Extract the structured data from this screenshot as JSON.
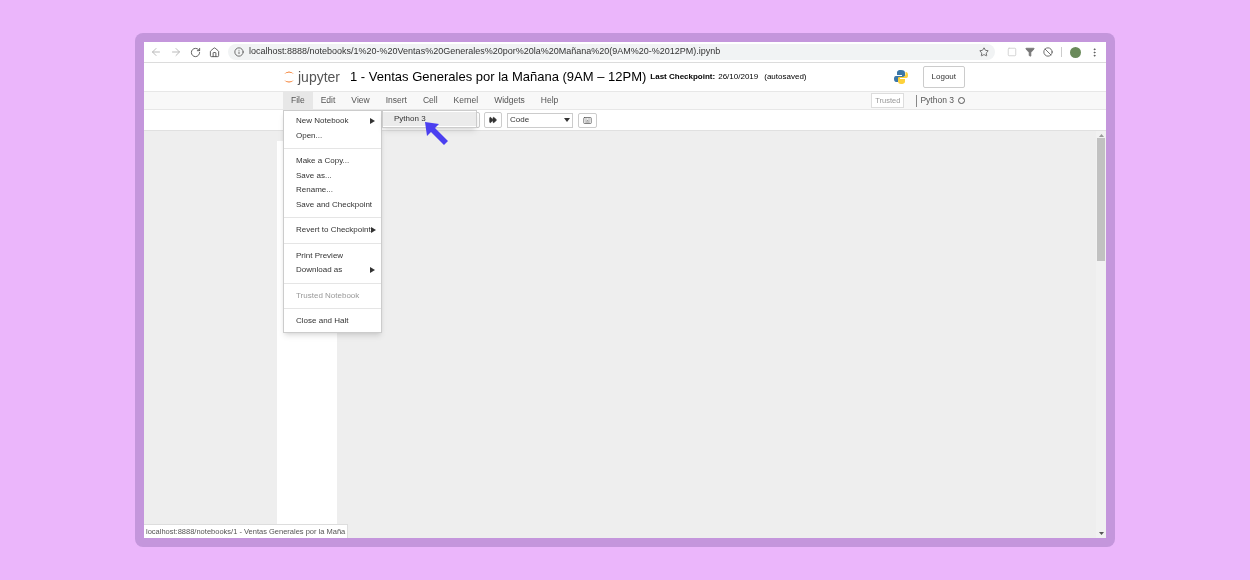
{
  "browser": {
    "url": "localhost:8888/notebooks/1%20-%20Ventas%20Generales%20por%20la%20Mañana%20(9AM%20-%2012PM).ipynb",
    "status_url": "localhost:8888/notebooks/1 - Ventas Generales por la Maña"
  },
  "header": {
    "logo_text": "jupyter",
    "title": "1 - Ventas Generales por la Mañana (9AM – 12PM)",
    "checkpoint_label": "Last Checkpoint:",
    "checkpoint_date": "26/10/2019",
    "autosave": "(autosaved)",
    "logout": "Logout"
  },
  "menubar": {
    "items": [
      {
        "label": "File",
        "selected": true
      },
      {
        "label": "Edit",
        "selected": false
      },
      {
        "label": "View",
        "selected": false
      },
      {
        "label": "Insert",
        "selected": false
      },
      {
        "label": "Cell",
        "selected": false
      },
      {
        "label": "Kernel",
        "selected": false
      },
      {
        "label": "Widgets",
        "selected": false
      },
      {
        "label": "Help",
        "selected": false
      }
    ],
    "trusted": "Trusted",
    "kernel": "Python 3"
  },
  "toolbar": {
    "cell_type": "Code"
  },
  "file_menu": {
    "groups": [
      [
        {
          "label": "New Notebook",
          "submenu": true,
          "disabled": false
        },
        {
          "label": "Open...",
          "submenu": false,
          "disabled": false
        }
      ],
      [
        {
          "label": "Make a Copy...",
          "submenu": false,
          "disabled": false
        },
        {
          "label": "Save as...",
          "submenu": false,
          "disabled": false
        },
        {
          "label": "Rename...",
          "submenu": false,
          "disabled": false
        },
        {
          "label": "Save and Checkpoint",
          "submenu": false,
          "disabled": false
        }
      ],
      [
        {
          "label": "Revert to Checkpoint",
          "submenu": true,
          "disabled": false
        }
      ],
      [
        {
          "label": "Print Preview",
          "submenu": false,
          "disabled": false
        },
        {
          "label": "Download as",
          "submenu": true,
          "disabled": false
        }
      ],
      [
        {
          "label": "Trusted Notebook",
          "submenu": false,
          "disabled": true
        }
      ],
      [
        {
          "label": "Close and Halt",
          "submenu": false,
          "disabled": false
        }
      ]
    ],
    "submenu": [
      {
        "label": "Python 3",
        "selected": true
      }
    ]
  }
}
